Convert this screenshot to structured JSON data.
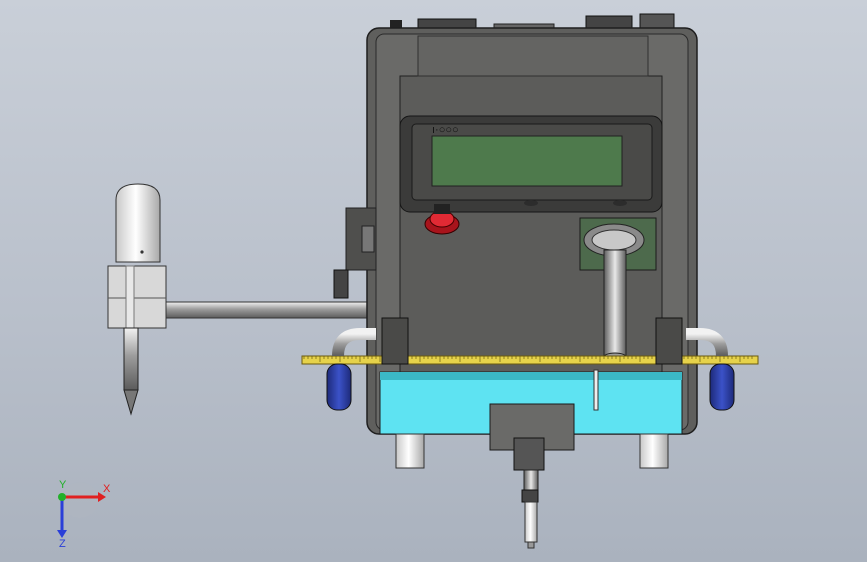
{
  "viewport": {
    "background_top": "#c9cfd8",
    "background_bottom": "#aab2be"
  },
  "triad": {
    "x_label": "X",
    "y_label": "Y",
    "z_label": "Z",
    "x_color": "#e02020",
    "y_color": "#22b02a",
    "z_color": "#2a3fd8"
  },
  "model": {
    "body_color": "#5f5f5d",
    "screen_color": "#4e7a4c",
    "base_color": "#5ee3f2",
    "ruler_color": "#e6d24a",
    "cylinder_color": "#2d3fa8",
    "estop_color": "#d2202a",
    "display_icon_text": "ı·○○○"
  }
}
